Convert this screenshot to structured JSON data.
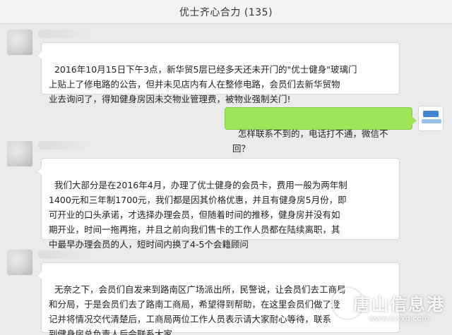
{
  "header": {
    "title": "优士齐心合力 (135)"
  },
  "messages": [
    {
      "side": "left",
      "text": "2016年10月15日下午3点，新华贸5层已经多天还未开门的\"优士健身\"玻璃门\n上贴上了修电路的公告，但并未见店内有人在整修电路，会员们去新华贸物\n业去询问了，得知健身房因未交物业管理费，被物业强制关门!"
    },
    {
      "side": "right",
      "text": "怎样联系不到的，电话打不通，微信不回？"
    },
    {
      "side": "left",
      "text": "我们大部分是在2016年4月，办理了优士健身的会员卡，费用一般为两年制\n1400元和三年制1700元，我们都是因其价格优惠，并且有健身房5月份，即\n可开业的口头承诺，才选择办理会员，但随着时间的推移，健身房并没有如\n期开业，时间一拖再拖，并且之前向我们售卡的工作人员都在陆续离职，其\n中最早办理会员的人，短时间内换了4-5个会籍顾问"
    },
    {
      "side": "left",
      "text": "无奈之下，会员们自发来到路南区广场派出所，民警说，让会员们去工商局\n和分局，于是会员们去了路南工商局，希望得到帮助，在这里会员们做了登\n记并将情况交代清楚后，工商局两位工作人员表示请大家耐心等待，联系\n到健身房总负责人后会联系大家。"
    }
  ],
  "watermark": {
    "name": "唐山信息港",
    "url": "www.tssxg.com"
  }
}
